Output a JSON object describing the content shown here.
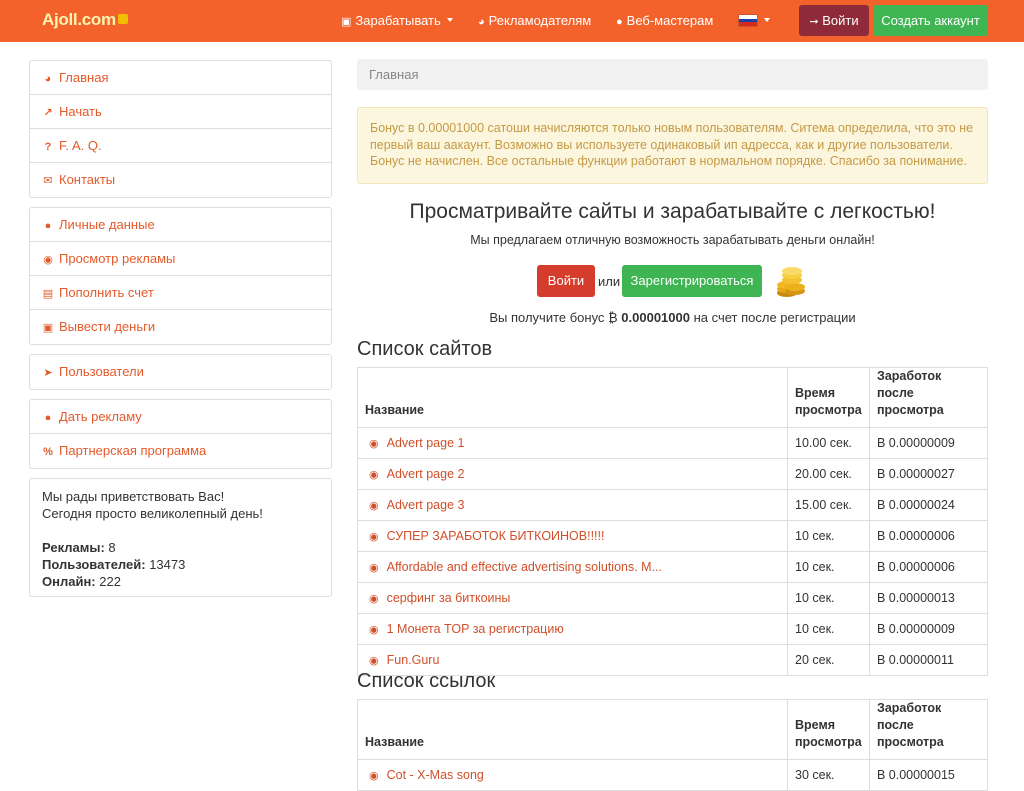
{
  "navbar": {
    "brand": "Ajoll.com",
    "items": [
      {
        "label": "Зарабатывать",
        "dropdown": true
      },
      {
        "label": "Рекламодателям",
        "dropdown": false
      },
      {
        "label": "Веб-мастерам",
        "dropdown": false
      }
    ],
    "language": "ru",
    "login_label": "Войти",
    "create_label": "Создать аккаунт"
  },
  "sidebar": {
    "group1": [
      {
        "label": "Главная",
        "icon": "dashboard-icon"
      },
      {
        "label": "Начать",
        "icon": "chart-icon"
      },
      {
        "label": "F. A. Q.",
        "icon": "question-icon"
      },
      {
        "label": "Контакты",
        "icon": "envelope-icon"
      }
    ],
    "group2": [
      {
        "label": "Личные данные",
        "icon": "user-icon"
      },
      {
        "label": "Просмотр рекламы",
        "icon": "eye-icon"
      },
      {
        "label": "Пополнить счет",
        "icon": "credit-card-icon"
      },
      {
        "label": "Вывести деньги",
        "icon": "money-icon"
      }
    ],
    "group3": [
      {
        "label": "Пользователи",
        "icon": "rocket-icon"
      }
    ],
    "group4": [
      {
        "label": "Дать рекламу",
        "icon": "globe-icon"
      },
      {
        "label": "Партнерская программа",
        "icon": "percent-icon"
      }
    ],
    "info": {
      "greeting1": "Мы рады приветствовать Вас!",
      "greeting2": "Сегодня просто великолепный день!",
      "ads_label": "Рекламы:",
      "ads_value": "8",
      "users_label": "Пользователей:",
      "users_value": "13473",
      "online_label": "Онлайн:",
      "online_value": "222"
    }
  },
  "main": {
    "breadcrumb": "Главная",
    "alert": "Бонус в 0.00001000 сатоши начисляются только новым пользователям. Ситема определила, что это не первый ваш аакаунт. Возможно вы используете одинаковый ип адресса, как и другие пользователи. Бонус не начислен. Все остальные функции работают в нормальном порядке. Спасибо за понимание.",
    "hero_title": "Просматривайте сайты и зарабатывайте с легкостью!",
    "hero_sub": "Мы предлагаем отличную возможность зарабатывать деньги онлайн!",
    "login_label": "Войти",
    "or_label": "или",
    "register_label": "Зарегистрироваться",
    "bonus_prefix": "Вы получите бонус ",
    "bonus_currency": "₿",
    "bonus_amount": "0.00001000",
    "bonus_suffix": " на счет после регистрации"
  },
  "sites": {
    "title": "Список сайтов",
    "headers": {
      "name": "Название",
      "time": "Время просмотра",
      "earn": "Заработок после просмотра"
    },
    "rows": [
      {
        "name": "Advert page 1",
        "time": "10.00 сек.",
        "earn": "B 0.00000009"
      },
      {
        "name": "Advert page 2",
        "time": "20.00 сек.",
        "earn": "B 0.00000027"
      },
      {
        "name": "Advert page 3",
        "time": "15.00 сек.",
        "earn": "B 0.00000024"
      },
      {
        "name": "СУПЕР ЗАРАБОТОК БИТКОИНОВ!!!!!",
        "time": "10 сек.",
        "earn": "B 0.00000006"
      },
      {
        "name": "Affordable and effective advertising solutions. M...",
        "time": "10 сек.",
        "earn": "B 0.00000006"
      },
      {
        "name": "серфинг за биткоины",
        "time": "10 сек.",
        "earn": "B 0.00000013"
      },
      {
        "name": "1 Монета TOP за регистрацию",
        "time": "10 сек.",
        "earn": "B 0.00000009"
      },
      {
        "name": "Fun.Guru",
        "time": "20 сек.",
        "earn": "B 0.00000011"
      }
    ]
  },
  "links": {
    "title": "Список ссылок",
    "headers": {
      "name": "Название",
      "time": "Время просмотра",
      "earn": "Заработок после просмотра"
    },
    "rows": [
      {
        "name": "Cot - X-Mas song",
        "time": "30 сек.",
        "earn": "B 0.00000015"
      }
    ]
  }
}
